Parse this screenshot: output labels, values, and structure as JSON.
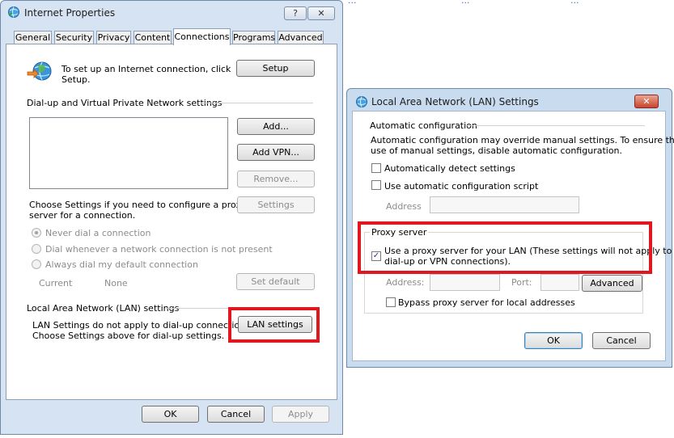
{
  "background": {
    "top_link_fragments": [
      "...",
      "...",
      "..."
    ],
    "bottom_right_fragment": "..."
  },
  "internet_properties": {
    "title": "Internet Properties",
    "help_button": "?",
    "close_button": "✕",
    "tabs": [
      {
        "label": "General"
      },
      {
        "label": "Security"
      },
      {
        "label": "Privacy"
      },
      {
        "label": "Content"
      },
      {
        "label": "Connections"
      },
      {
        "label": "Programs"
      },
      {
        "label": "Advanced"
      }
    ],
    "active_tab": "Connections",
    "setup_text_line1": "To set up an Internet connection, click",
    "setup_text_line2": "Setup.",
    "setup_button": "Setup",
    "vpn_section_label": "Dial-up and Virtual Private Network settings",
    "add_button": "Add...",
    "add_vpn_button": "Add VPN...",
    "remove_button": "Remove...",
    "settings_button": "Settings",
    "choose_settings_line1": "Choose Settings if you need to configure a proxy",
    "choose_settings_line2": "server for a connection.",
    "radio_never": "Never dial a connection",
    "radio_whenever": "Dial whenever a network connection is not present",
    "radio_always": "Always dial my default connection",
    "current_label": "Current",
    "current_value": "None",
    "set_default_button": "Set default",
    "lan_section_label": "Local Area Network (LAN) settings",
    "lan_text_line1": "LAN Settings do not apply to dial-up connections.",
    "lan_text_line2": "Choose Settings above for dial-up settings.",
    "lan_settings_button": "LAN settings",
    "ok_button": "OK",
    "cancel_button": "Cancel",
    "apply_button": "Apply"
  },
  "lan_settings": {
    "title": "Local Area Network (LAN) Settings",
    "close_button": "✕",
    "auto_config_label": "Automatic configuration",
    "auto_config_desc_line1": "Automatic configuration may override manual settings.  To ensure the",
    "auto_config_desc_line2": "use of manual settings, disable automatic configuration.",
    "auto_detect_label": "Automatically detect settings",
    "auto_detect_checked": false,
    "auto_script_label": "Use automatic configuration script",
    "auto_script_checked": false,
    "address_label": "Address",
    "address_value": "",
    "proxy_group_label": "Proxy server",
    "use_proxy_line1": "Use a proxy server for your LAN (These settings will not apply to",
    "use_proxy_line2": "dial-up or VPN connections).",
    "use_proxy_checked": true,
    "check_mark": "✓",
    "proxy_address_label": "Address:",
    "proxy_address_value": "",
    "port_label": "Port:",
    "port_value": "",
    "advanced_button": "Advanced",
    "bypass_label": "Bypass proxy server for local addresses",
    "bypass_checked": false,
    "ok_button": "OK",
    "cancel_button": "Cancel"
  },
  "colors": {
    "highlight": "#e0171f",
    "window_frame": "#d6e3f2",
    "close_button": "#c8432d"
  },
  "icons": [
    "internet-properties-icon",
    "globe-connection-icon",
    "lan-settings-icon",
    "check-icon"
  ]
}
